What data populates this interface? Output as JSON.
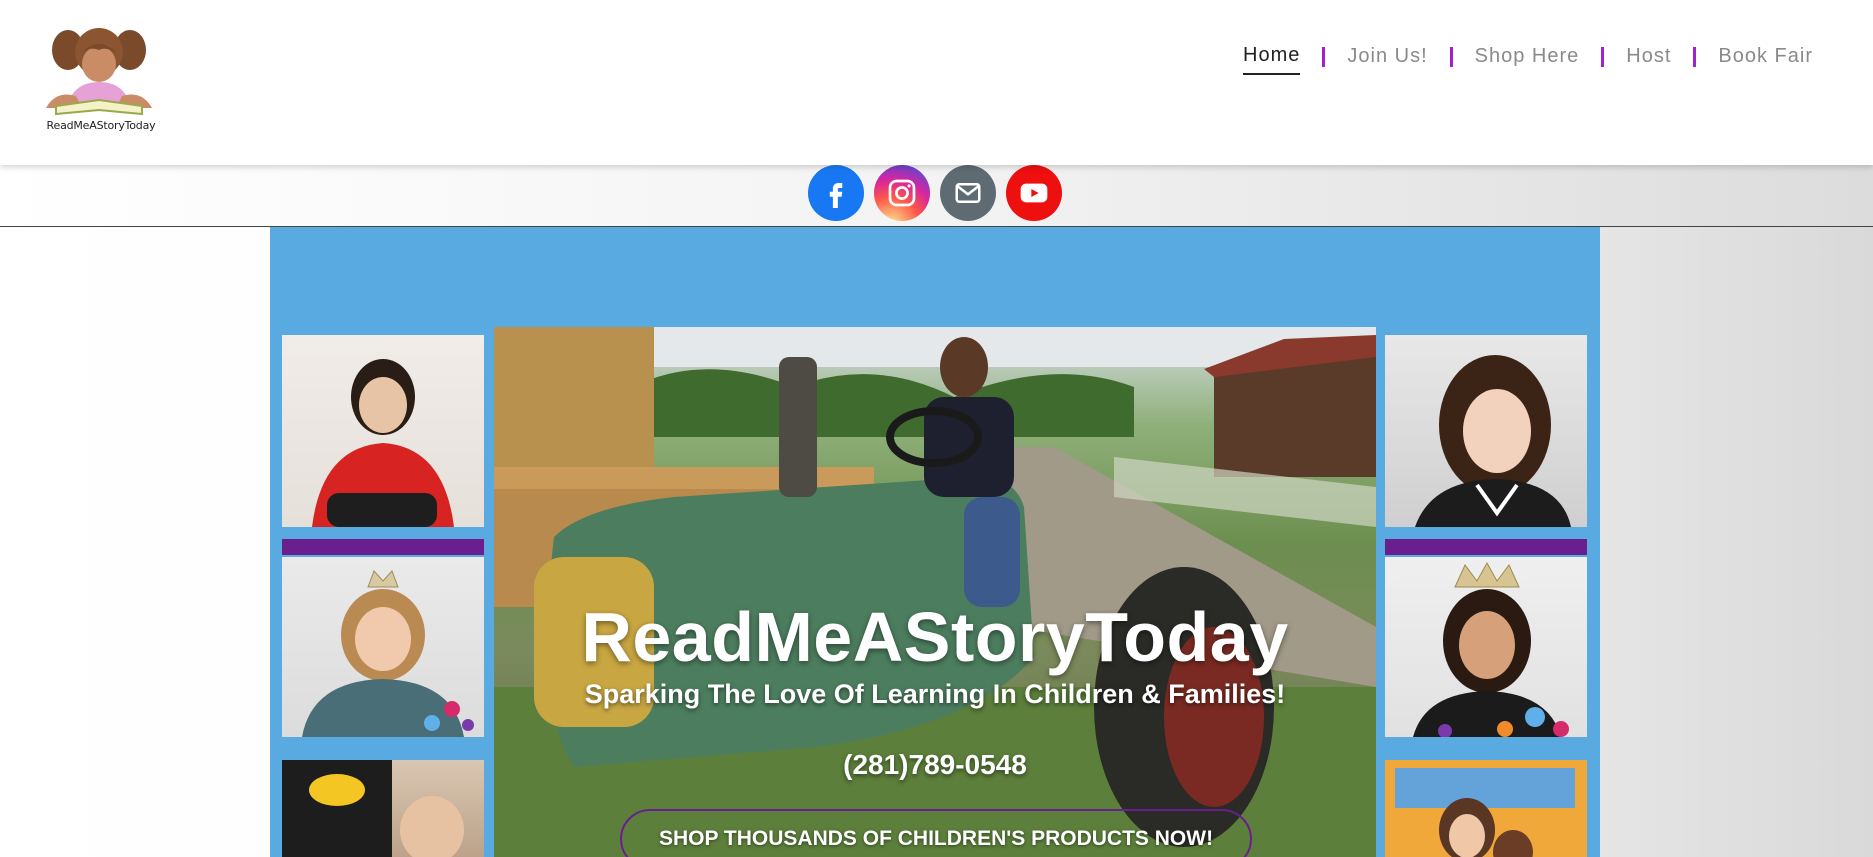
{
  "logo": {
    "text": "ReadMeAStoryToday",
    "icon": "girl-reading-logo"
  },
  "nav": {
    "items": [
      {
        "label": "Home",
        "active": true
      },
      {
        "label": "Join Us!",
        "active": false
      },
      {
        "label": "Shop Here",
        "active": false
      },
      {
        "label": "Host",
        "active": false
      },
      {
        "label": "Book Fair",
        "active": false
      }
    ],
    "separator_color": "#a31fd6"
  },
  "social": [
    {
      "name": "facebook-icon",
      "color": "#1877f2"
    },
    {
      "name": "instagram-icon",
      "color": "#d6249f"
    },
    {
      "name": "email-icon",
      "color": "#5f6b72"
    },
    {
      "name": "youtube-icon",
      "color": "#ee0f0f"
    }
  ],
  "hero": {
    "background_color": "#5aaae2",
    "title": "ReadMeAStoryToday",
    "subtitle": "Sparking The Love Of Learning In Children & Families!",
    "phone": "(281)789-0548",
    "cta": "SHOP THOUSANDS OF CHILDREN'S PRODUCTS NOW!",
    "accent_color": "#6a1f8f"
  }
}
